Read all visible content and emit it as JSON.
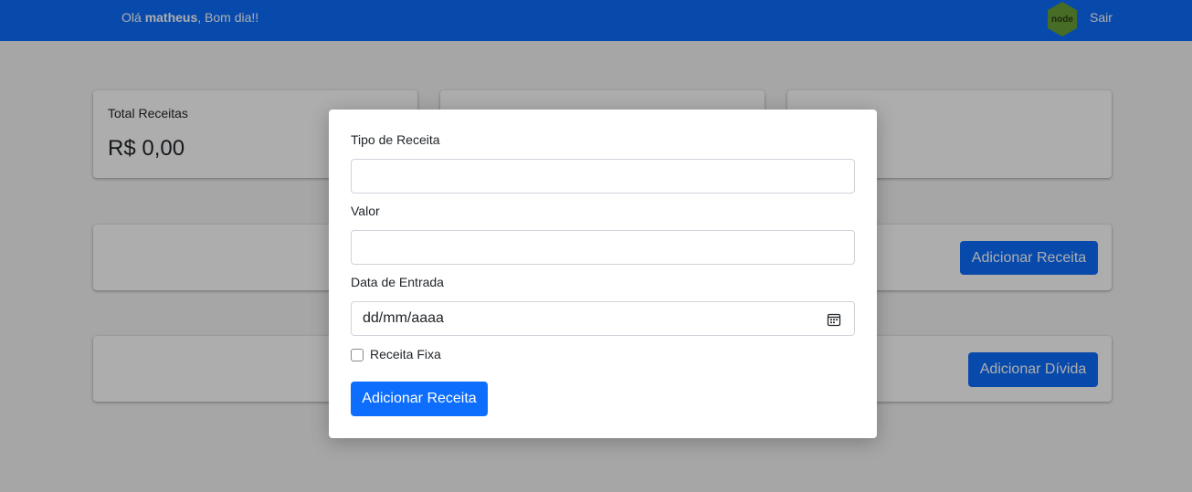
{
  "header": {
    "greeting_prefix": "Olá ",
    "user_name": "matheus",
    "greeting_suffix": ", Bom dia!!",
    "logout_label": "Sair",
    "logo_text": "node"
  },
  "summary": {
    "income_title": "Total Receitas",
    "income_value": "R$ 0,00"
  },
  "actions": {
    "add_income_label": "Adicionar Receita",
    "add_debt_label": "Adicionar Dívida"
  },
  "modal": {
    "type_label": "Tipo de Receita",
    "type_value": "",
    "amount_label": "Valor",
    "amount_value": "",
    "date_label": "Data de Entrada",
    "date_placeholder": "dd/mm/aaaa",
    "fixed_label": "Receita Fixa",
    "fixed_checked": false,
    "submit_label": "Adicionar Receita"
  },
  "colors": {
    "primary": "#0d6efd",
    "overlay": "rgba(0,0,0,0.32)",
    "node_green": "#689f38"
  }
}
